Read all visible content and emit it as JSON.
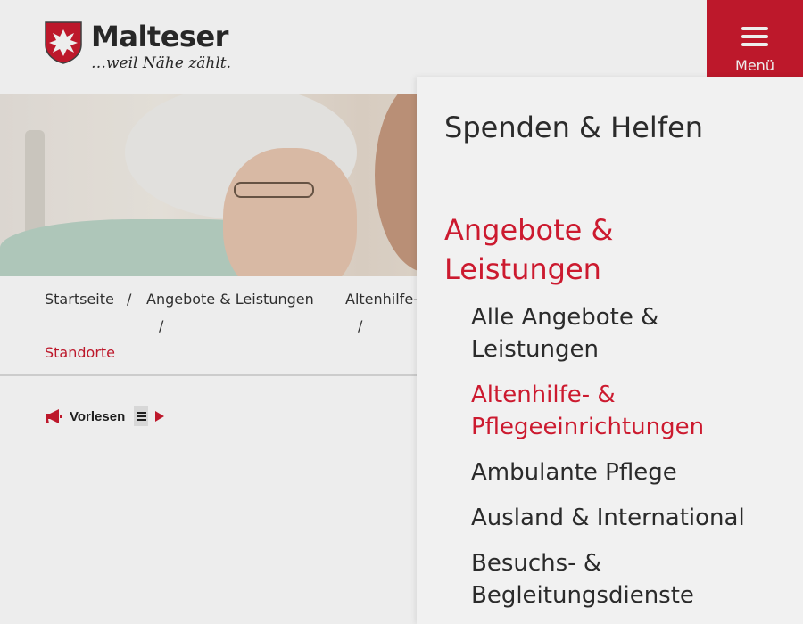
{
  "header": {
    "logo_name": "Malteser",
    "logo_claim": "…weil Nähe zählt.",
    "menu_label": "Menü"
  },
  "breadcrumb": {
    "items": [
      "Startseite",
      "Angebote & Leistungen",
      "Altenhilfe-",
      "Standorte"
    ],
    "separator": "/"
  },
  "readaloud": {
    "label": "Vorlesen"
  },
  "panel": {
    "title": "Spenden & Helfen",
    "section": "Angebote & Leistungen",
    "items": [
      {
        "label": "Alle Angebote & Leistungen"
      },
      {
        "label": "Altenhilfe- & Pflegeeinrichtungen"
      },
      {
        "label": "Ambulante Pflege"
      },
      {
        "label": "Ausland & International"
      },
      {
        "label": "Besuchs- & Begleitungsdienste"
      }
    ]
  },
  "colors": {
    "brand_red": "#cc1a2f",
    "panel_bg": "#f1f1f1"
  },
  "icons": {
    "menu": "hamburger-icon",
    "readaloud": "megaphone-icon",
    "list": "list-icon",
    "play": "play-icon"
  }
}
